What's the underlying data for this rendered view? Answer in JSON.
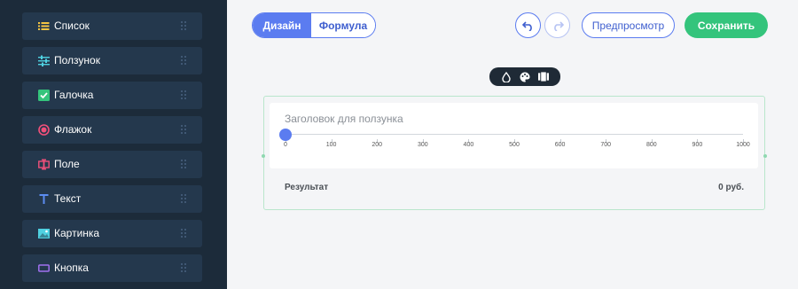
{
  "sidebar": {
    "items": [
      {
        "label": "Список",
        "icon": "list-icon",
        "color": "#f5c542"
      },
      {
        "label": "Ползунок",
        "icon": "sliders-icon",
        "color": "#4fd0e0"
      },
      {
        "label": "Галочка",
        "icon": "checkbox-icon",
        "color": "#34c47c"
      },
      {
        "label": "Флажок",
        "icon": "radio-icon",
        "color": "#f0507a"
      },
      {
        "label": "Поле",
        "icon": "input-field-icon",
        "color": "#f0507a"
      },
      {
        "label": "Текст",
        "icon": "text-icon",
        "color": "#5b8cf0"
      },
      {
        "label": "Картинка",
        "icon": "image-icon",
        "color": "#4fd0e0"
      },
      {
        "label": "Кнопка",
        "icon": "button-icon",
        "color": "#a070f0"
      }
    ]
  },
  "toolbar": {
    "design_label": "Дизайн",
    "formula_label": "Формула",
    "preview_label": "Предпросмотр",
    "save_label": "Сохранить"
  },
  "widget": {
    "title_placeholder": "Заголовок для ползунка",
    "ticks": [
      "0",
      "100",
      "200",
      "300",
      "400",
      "500",
      "600",
      "700",
      "800",
      "900",
      "1000"
    ],
    "value": 0,
    "min": 0,
    "max": 1000,
    "result_label": "Результат",
    "result_value": "0 руб."
  },
  "colors": {
    "accent": "#5b7cf0",
    "save": "#34c47c",
    "sidebar_bg": "#1c2b3a",
    "sidebar_item_bg": "#24384d"
  }
}
